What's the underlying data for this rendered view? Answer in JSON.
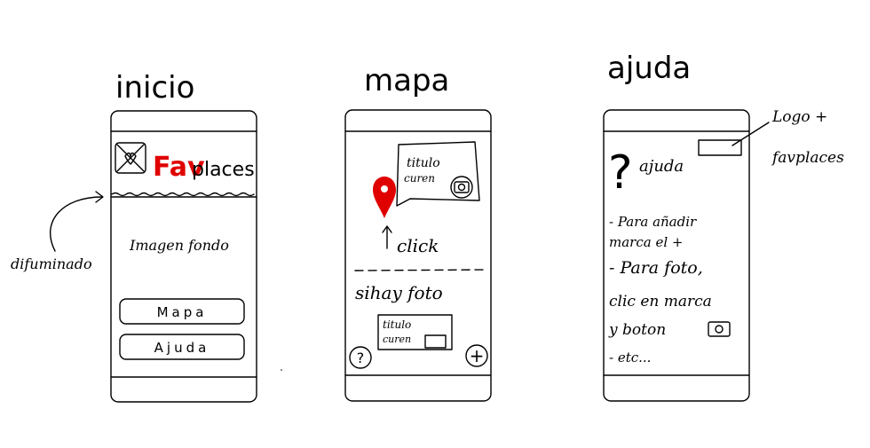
{
  "screens": {
    "inicio": {
      "title": "inicio",
      "logo_fav": "Fav",
      "logo_places": "places",
      "background_label": "Imagen fondo",
      "buttons": [
        "Mapa",
        "Ajuda"
      ],
      "annotation": "difuminado"
    },
    "mapa": {
      "title": "mapa",
      "popup_line1": "titulo",
      "popup_line2": "curen",
      "click_label": "click",
      "photo_label": "sihay foto",
      "card_line1": "titulo",
      "card_line2": "curen",
      "help_symbol": "?",
      "add_symbol": "+"
    },
    "ajuda": {
      "title": "ajuda",
      "help_symbol": "?",
      "header_label": "ajuda",
      "annotation_line1": "Logo +",
      "annotation_line2": "favplaces",
      "text_lines": [
        "- Para añadir",
        "marca el +",
        "- Para foto,",
        "clic en marca",
        "y boton",
        "- etc..."
      ]
    }
  },
  "colors": {
    "accent": "#e00000",
    "ink": "#000000"
  }
}
